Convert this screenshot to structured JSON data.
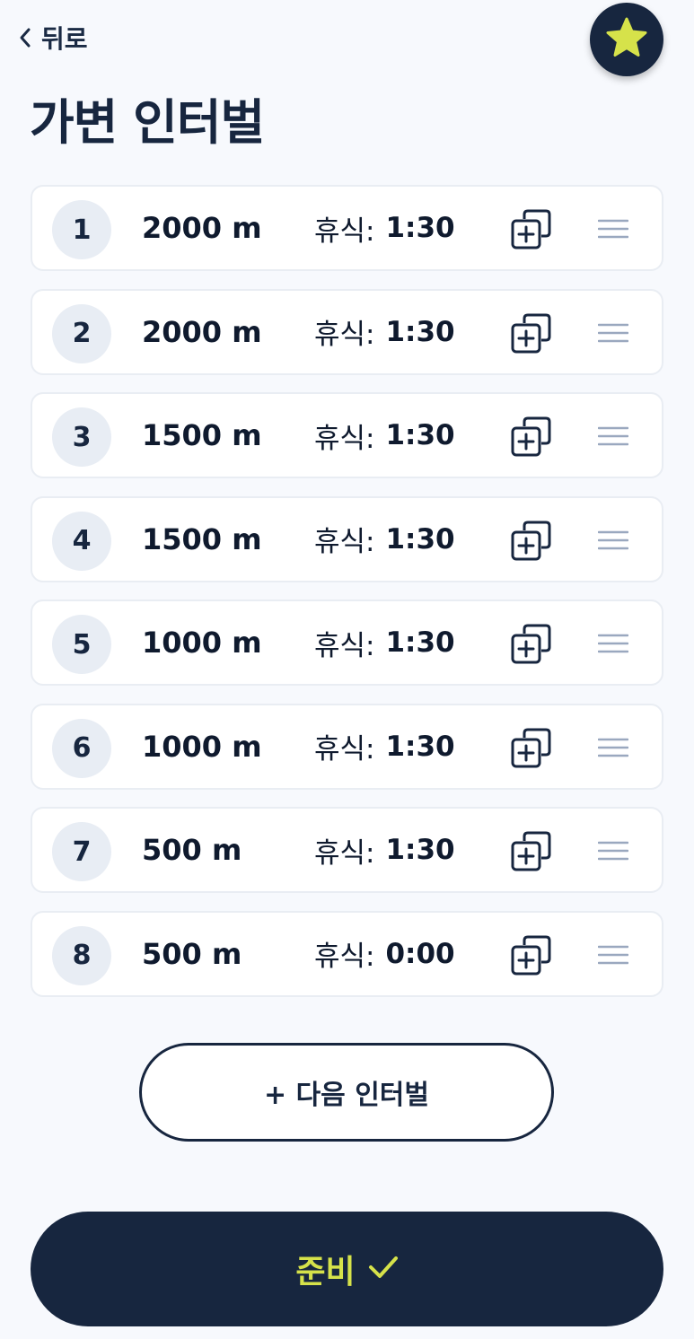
{
  "header": {
    "back_label": "뒤로",
    "title": "가변 인터벌"
  },
  "intervals": [
    {
      "num": "1",
      "distance": "2000 m",
      "rest_label": "휴식:",
      "rest_value": "1:30"
    },
    {
      "num": "2",
      "distance": "2000 m",
      "rest_label": "휴식:",
      "rest_value": "1:30"
    },
    {
      "num": "3",
      "distance": "1500 m",
      "rest_label": "휴식:",
      "rest_value": "1:30"
    },
    {
      "num": "4",
      "distance": "1500 m",
      "rest_label": "휴식:",
      "rest_value": "1:30"
    },
    {
      "num": "5",
      "distance": "1000 m",
      "rest_label": "휴식:",
      "rest_value": "1:30"
    },
    {
      "num": "6",
      "distance": "1000 m",
      "rest_label": "휴식:",
      "rest_value": "1:30"
    },
    {
      "num": "7",
      "distance": "500 m",
      "rest_label": "휴식:",
      "rest_value": "1:30"
    },
    {
      "num": "8",
      "distance": "500 m",
      "rest_label": "휴식:",
      "rest_value": "0:00"
    }
  ],
  "actions": {
    "next_interval_label": "+ 다음 인터벌",
    "ready_label": "준비"
  },
  "icons": {
    "back": "chevron-left-icon",
    "favorite": "star-icon",
    "duplicate": "duplicate-add-icon",
    "drag": "drag-handle-icon",
    "ready": "check-icon"
  },
  "colors": {
    "primary": "#17263f",
    "accent": "#d6e24a",
    "background": "#f7f9fd",
    "row_border": "#e9edf3",
    "num_badge": "#e8edf4",
    "drag_handle": "#9aa8bf"
  }
}
